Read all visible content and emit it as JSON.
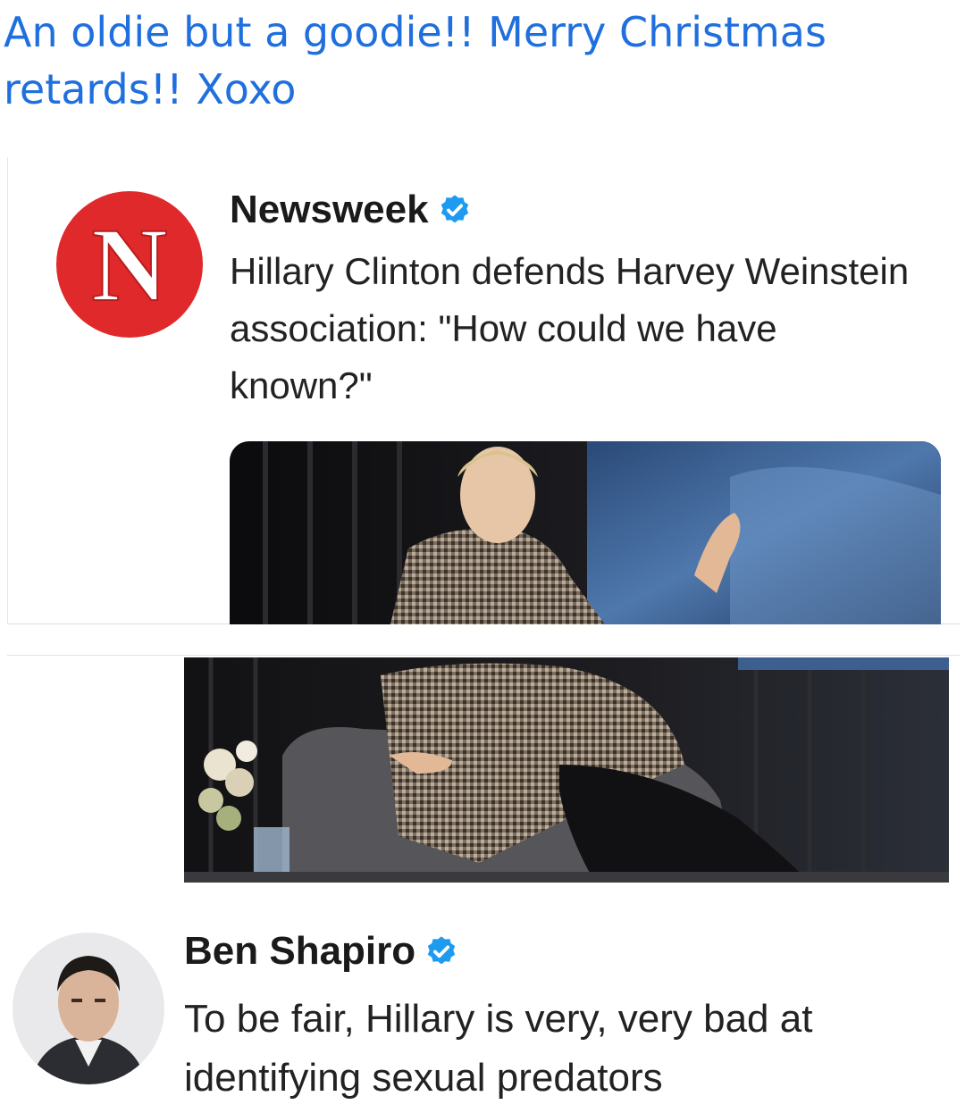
{
  "caption": "An oldie but a goodie!! Merry Christmas retards!! Xoxo",
  "colors": {
    "caption": "#1f6fde",
    "verified": "#1d9bf0",
    "newsweek_red": "#e0292b"
  },
  "newsweek_tweet": {
    "name": "Newsweek",
    "verified_icon": "verified-badge-icon",
    "text": "Hillary Clinton defends Harvey Weinstein association: \"How could we have known?\"",
    "logo_letter": "N"
  },
  "shapiro_tweet": {
    "name": "Ben Shapiro",
    "verified_icon": "verified-badge-icon",
    "text": "To be fair, Hillary is very, very bad at identifying sexual predators"
  }
}
